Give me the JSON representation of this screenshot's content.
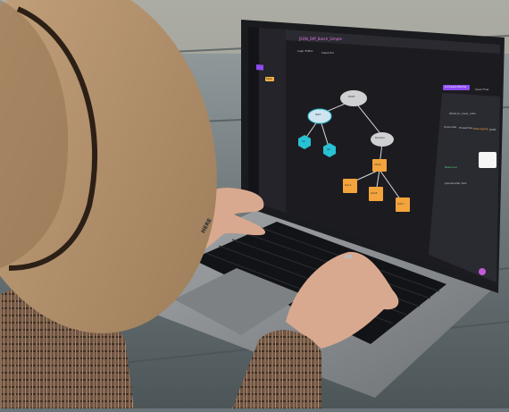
{
  "photo": {
    "subject": "Person in a tan wide-brim hat and plaid coat typing on a laptop at a wooden picnic table",
    "colors": {
      "hat": "#b28f6a",
      "hat_band": "#2c2016",
      "table": "#5f6a6f",
      "laptop_body": "#8f9296",
      "keyboard": "#121316",
      "screen_bg": "#1c1c20",
      "accent_purple": "#8d4cf0",
      "accent_pink": "#e27be6",
      "node_orange": "#f3a43c",
      "node_teal": "#29c1d4",
      "node_gray": "#cfd0d2",
      "coat": "#6e5442",
      "skin": "#d9a98f"
    },
    "tattoo_text": "HERE"
  },
  "app": {
    "tab_title": "JSON_Diff_Batch_Simple",
    "sub_tab_1": "Logic Editor",
    "sub_tab_2": "Inspector",
    "sidebar_tag": "Step",
    "top_button": "Compare Blocks",
    "top_button_2": "Save Flow",
    "panel_title": "What_to_clear_note",
    "panel_tab_1": "Overview",
    "panel_tab_2": "Properties",
    "panel_tab_3": "Debugging",
    "panel_tab_4": "JSON",
    "panel_status": "Resolved",
    "panel_field": "placeholder text",
    "root_node": "ROOT",
    "left_node": "Start",
    "right_node": "Decision",
    "hex_1": "Val",
    "hex_2": "Val",
    "mid_box": "Check",
    "box_1": "Out A",
    "box_2": "Out B",
    "box_3": "Out C"
  }
}
